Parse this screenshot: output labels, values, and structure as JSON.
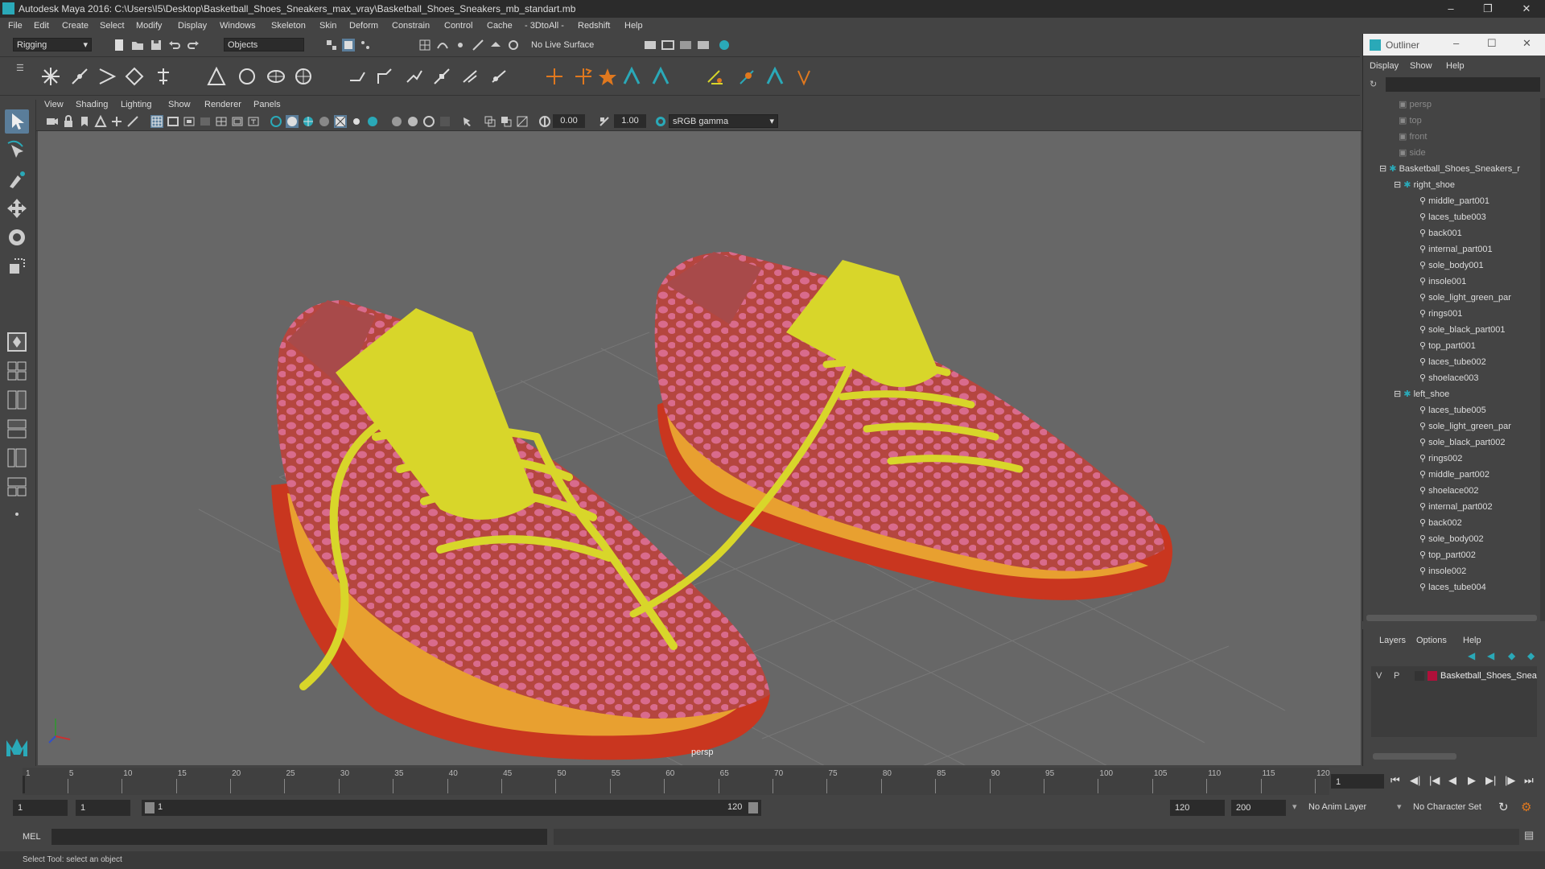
{
  "window": {
    "title": "Autodesk Maya 2016: C:\\Users\\I5\\Desktop\\Basketball_Shoes_Sneakers_max_vray\\Basketball_Shoes_Sneakers_mb_standart.mb"
  },
  "menubar": [
    "File",
    "Edit",
    "Create",
    "Select",
    "Modify",
    "Display",
    "Windows",
    "Skeleton",
    "Skin",
    "Deform",
    "Constrain",
    "Control",
    "Cache",
    "- 3DtoAll -",
    "Redshift",
    "Help"
  ],
  "statusline": {
    "mode": "Rigging",
    "selection_mask": "Objects",
    "live_surface": "No Live Surface"
  },
  "viewport": {
    "menus": [
      "View",
      "Shading",
      "Lighting",
      "Show",
      "Renderer",
      "Panels"
    ],
    "exposure": "0.00",
    "gamma": "1.00",
    "color_space": "sRGB gamma",
    "camera_label": "persp"
  },
  "outliner": {
    "title": "Outliner",
    "menus": [
      "Display",
      "Show",
      "Help"
    ],
    "cameras": [
      "persp",
      "top",
      "front",
      "side"
    ],
    "root": "Basketball_Shoes_Sneakers_r",
    "groups": [
      {
        "name": "right_shoe",
        "children": [
          "middle_part001",
          "laces_tube003",
          "back001",
          "internal_part001",
          "sole_body001",
          "insole001",
          "sole_light_green_par",
          "rings001",
          "sole_black_part001",
          "top_part001",
          "laces_tube002",
          "shoelace003"
        ]
      },
      {
        "name": "left_shoe",
        "children": [
          "laces_tube005",
          "sole_light_green_par",
          "sole_black_part002",
          "rings002",
          "middle_part002",
          "shoelace002",
          "internal_part002",
          "back002",
          "sole_body002",
          "top_part002",
          "insole002",
          "laces_tube004"
        ]
      }
    ]
  },
  "layers": {
    "menus": [
      "Layers",
      "Options",
      "Help"
    ],
    "layer": {
      "v": "V",
      "p": "P",
      "name": "Basketball_Shoes_Snea",
      "color": "#b0103a"
    }
  },
  "timeline": {
    "ticks": [
      "1",
      "5",
      "10",
      "15",
      "20",
      "25",
      "30",
      "35",
      "40",
      "45",
      "50",
      "55",
      "60",
      "65",
      "70",
      "75",
      "80",
      "85",
      "90",
      "95",
      "100",
      "105",
      "110",
      "115",
      "120"
    ],
    "current_frame": "1"
  },
  "range": {
    "start": "1",
    "playback_start": "1",
    "slider_start": "1",
    "slider_end": "120",
    "playback_end": "120",
    "end": "200",
    "anim_layer": "No Anim Layer",
    "char_set": "No Character Set"
  },
  "command": {
    "lang": "MEL"
  },
  "help": {
    "text": "Select Tool: select an object"
  },
  "colors": {
    "accent": "#2aa9b8",
    "upper": "#c65a68",
    "laces": "#d8d62a",
    "sole": "#c82a1a"
  }
}
